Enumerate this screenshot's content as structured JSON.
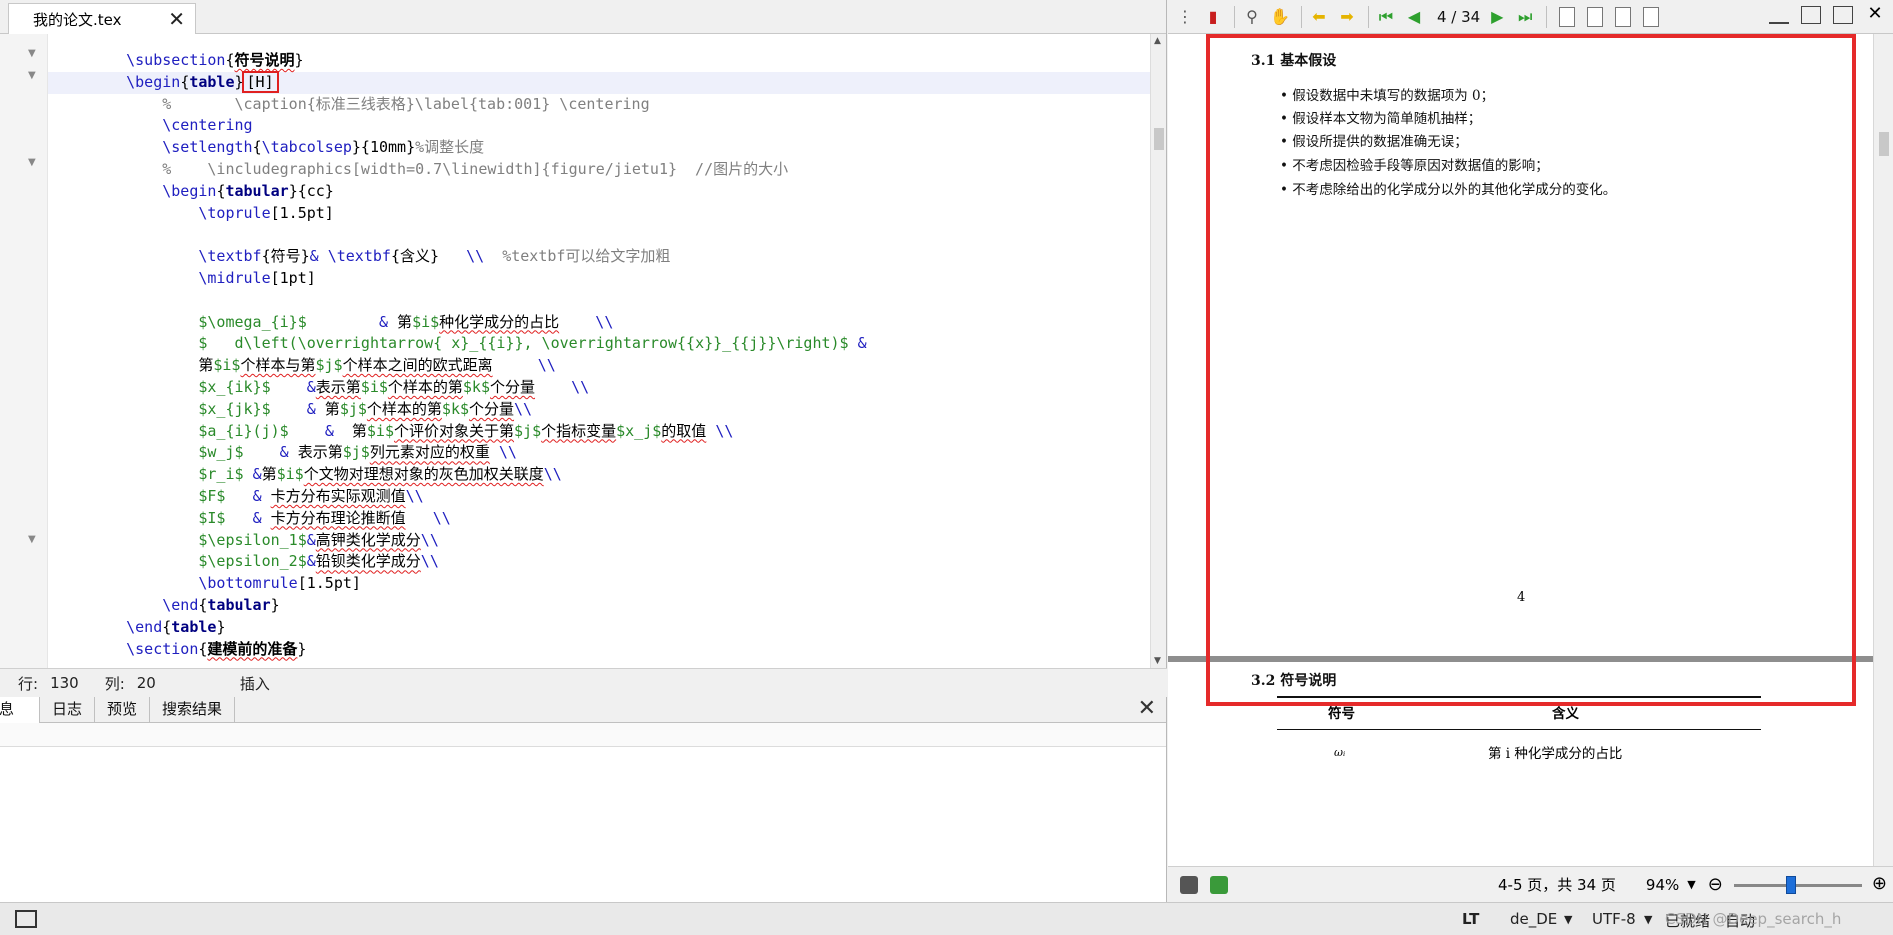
{
  "editor": {
    "tab_title": "我的论文.tex",
    "lines": [
      {
        "parts": [
          {
            "t": "    ",
            "c": ""
          },
          {
            "t": "\\subsection",
            "c": "kw"
          },
          {
            "t": "{",
            "c": ""
          },
          {
            "t": "符号说明",
            "c": "b"
          },
          {
            "t": "}",
            "c": ""
          }
        ]
      },
      {
        "parts": [
          {
            "t": "    ",
            "c": ""
          },
          {
            "t": "\\begin",
            "c": "kw"
          },
          {
            "t": "{",
            "c": ""
          },
          {
            "t": "table",
            "c": "kwb"
          },
          {
            "t": "}",
            "c": ""
          },
          {
            "t": "[H]",
            "c": "box"
          }
        ],
        "current": true
      },
      {
        "parts": [
          {
            "t": "        %       \\caption{标准三线表格}\\label{tab:001} \\centering",
            "c": "cm"
          }
        ]
      },
      {
        "parts": [
          {
            "t": "        ",
            "c": ""
          },
          {
            "t": "\\centering",
            "c": "kw"
          }
        ]
      },
      {
        "parts": [
          {
            "t": "        ",
            "c": ""
          },
          {
            "t": "\\setlength",
            "c": "kw"
          },
          {
            "t": "{",
            "c": ""
          },
          {
            "t": "\\tabcolsep",
            "c": "kw"
          },
          {
            "t": "}{10mm}",
            "c": ""
          },
          {
            "t": "%调整长度",
            "c": "cm"
          }
        ]
      },
      {
        "parts": [
          {
            "t": "        %    \\includegraphics[width=0.7\\linewidth]{figure/jietu1}  //图片的大小",
            "c": "cm"
          }
        ]
      },
      {
        "parts": [
          {
            "t": "        ",
            "c": ""
          },
          {
            "t": "\\begin",
            "c": "kw"
          },
          {
            "t": "{",
            "c": ""
          },
          {
            "t": "tabular",
            "c": "kwb"
          },
          {
            "t": "}{cc}",
            "c": ""
          }
        ]
      },
      {
        "parts": [
          {
            "t": "            ",
            "c": ""
          },
          {
            "t": "\\toprule",
            "c": "kw"
          },
          {
            "t": "[1.5pt]",
            "c": ""
          }
        ]
      },
      {
        "parts": [
          {
            "t": "",
            "c": ""
          }
        ]
      },
      {
        "parts": [
          {
            "t": "            ",
            "c": ""
          },
          {
            "t": "\\textbf",
            "c": "kw"
          },
          {
            "t": "{符号}",
            "c": ""
          },
          {
            "t": "&",
            "c": "kw"
          },
          {
            "t": " ",
            "c": ""
          },
          {
            "t": "\\textbf",
            "c": "kw"
          },
          {
            "t": "{含义}   ",
            "c": ""
          },
          {
            "t": "\\\\",
            "c": "kw"
          },
          {
            "t": "  %textbf可以给文字加粗",
            "c": "cm"
          }
        ]
      },
      {
        "parts": [
          {
            "t": "            ",
            "c": ""
          },
          {
            "t": "\\midrule",
            "c": "kw"
          },
          {
            "t": "[1pt]",
            "c": ""
          }
        ]
      },
      {
        "parts": [
          {
            "t": "",
            "c": ""
          }
        ]
      },
      {
        "parts": [
          {
            "t": "            ",
            "c": ""
          },
          {
            "t": "$\\omega_{i}$",
            "c": "ma"
          },
          {
            "t": "        ",
            "c": ""
          },
          {
            "t": "&",
            "c": "kw"
          },
          {
            "t": " 第",
            "c": ""
          },
          {
            "t": "$i$",
            "c": "ma"
          },
          {
            "t": "种化学成分的占比",
            "c": "sq"
          },
          {
            "t": "    ",
            "c": ""
          },
          {
            "t": "\\\\",
            "c": "kw"
          }
        ]
      },
      {
        "parts": [
          {
            "t": "            ",
            "c": ""
          },
          {
            "t": "$   d\\left(\\overrightarrow{ x}_{{i}}, \\overrightarrow{{x}}_{{j}}\\right)$",
            "c": "ma"
          },
          {
            "t": " ",
            "c": ""
          },
          {
            "t": "&",
            "c": "kw"
          }
        ]
      },
      {
        "parts": [
          {
            "t": "            第",
            "c": ""
          },
          {
            "t": "$i$",
            "c": "ma"
          },
          {
            "t": "个样本与第",
            "c": "sq"
          },
          {
            "t": "$j$",
            "c": "ma"
          },
          {
            "t": "个样本之间的欧式距离",
            "c": "sq"
          },
          {
            "t": "     ",
            "c": ""
          },
          {
            "t": "\\\\",
            "c": "kw"
          }
        ]
      },
      {
        "parts": [
          {
            "t": "            ",
            "c": ""
          },
          {
            "t": "$x_{ik}$",
            "c": "ma"
          },
          {
            "t": "    ",
            "c": ""
          },
          {
            "t": "&",
            "c": "kw"
          },
          {
            "t": "表示第",
            "c": "sq"
          },
          {
            "t": "$i$",
            "c": "ma"
          },
          {
            "t": "个样本的第",
            "c": "sq"
          },
          {
            "t": "$k$",
            "c": "ma"
          },
          {
            "t": "个分量",
            "c": "sq"
          },
          {
            "t": "    ",
            "c": ""
          },
          {
            "t": "\\\\",
            "c": "kw"
          }
        ]
      },
      {
        "parts": [
          {
            "t": "            ",
            "c": ""
          },
          {
            "t": "$x_{jk}$",
            "c": "ma"
          },
          {
            "t": "    ",
            "c": ""
          },
          {
            "t": "&",
            "c": "kw"
          },
          {
            "t": " 第",
            "c": ""
          },
          {
            "t": "$j$",
            "c": "ma"
          },
          {
            "t": "个样本的第",
            "c": "sq"
          },
          {
            "t": "$k$",
            "c": "ma"
          },
          {
            "t": "个分量",
            "c": "sq"
          },
          {
            "t": "\\\\",
            "c": "kw"
          }
        ]
      },
      {
        "parts": [
          {
            "t": "            ",
            "c": ""
          },
          {
            "t": "$a_{i}(j)$",
            "c": "ma"
          },
          {
            "t": "    ",
            "c": ""
          },
          {
            "t": "&",
            "c": "kw"
          },
          {
            "t": "  第",
            "c": ""
          },
          {
            "t": "$i$",
            "c": "ma"
          },
          {
            "t": "个评价对象关于第",
            "c": "sq"
          },
          {
            "t": "$j$",
            "c": "ma"
          },
          {
            "t": "个指标变量",
            "c": "sq"
          },
          {
            "t": "$x_j$",
            "c": "ma"
          },
          {
            "t": "的取值",
            "c": "sq"
          },
          {
            "t": " ",
            "c": ""
          },
          {
            "t": "\\\\",
            "c": "kw"
          }
        ]
      },
      {
        "parts": [
          {
            "t": "            ",
            "c": ""
          },
          {
            "t": "$w_j$",
            "c": "ma"
          },
          {
            "t": "    ",
            "c": ""
          },
          {
            "t": "&",
            "c": "kw"
          },
          {
            "t": " 表示第",
            "c": ""
          },
          {
            "t": "$j$",
            "c": "ma"
          },
          {
            "t": "列元素对应的权重",
            "c": "sq"
          },
          {
            "t": " ",
            "c": ""
          },
          {
            "t": "\\\\",
            "c": "kw"
          }
        ]
      },
      {
        "parts": [
          {
            "t": "            ",
            "c": ""
          },
          {
            "t": "$r_i$",
            "c": "ma"
          },
          {
            "t": " ",
            "c": ""
          },
          {
            "t": "&",
            "c": "kw"
          },
          {
            "t": "第",
            "c": ""
          },
          {
            "t": "$i$",
            "c": "ma"
          },
          {
            "t": "个文物对理想对象的灰色加权关联度",
            "c": "sq"
          },
          {
            "t": "\\\\",
            "c": "kw"
          }
        ]
      },
      {
        "parts": [
          {
            "t": "            ",
            "c": ""
          },
          {
            "t": "$F$",
            "c": "ma"
          },
          {
            "t": "   ",
            "c": ""
          },
          {
            "t": "&",
            "c": "kw"
          },
          {
            "t": " ",
            "c": ""
          },
          {
            "t": "卡方分布实际观测值",
            "c": "sq"
          },
          {
            "t": "\\\\",
            "c": "kw"
          }
        ]
      },
      {
        "parts": [
          {
            "t": "            ",
            "c": ""
          },
          {
            "t": "$I$",
            "c": "ma"
          },
          {
            "t": "   ",
            "c": ""
          },
          {
            "t": "&",
            "c": "kw"
          },
          {
            "t": " ",
            "c": ""
          },
          {
            "t": "卡方分布理论推断值",
            "c": "sq"
          },
          {
            "t": "   ",
            "c": ""
          },
          {
            "t": "\\\\",
            "c": "kw"
          }
        ]
      },
      {
        "parts": [
          {
            "t": "            ",
            "c": ""
          },
          {
            "t": "$\\epsilon_1$",
            "c": "ma"
          },
          {
            "t": "&",
            "c": "kw"
          },
          {
            "t": "高钾类化学成分",
            "c": "sq"
          },
          {
            "t": "\\\\",
            "c": "kw"
          }
        ]
      },
      {
        "parts": [
          {
            "t": "            ",
            "c": ""
          },
          {
            "t": "$\\epsilon_2$",
            "c": "ma"
          },
          {
            "t": "&",
            "c": "kw"
          },
          {
            "t": "铅钡类化学成分",
            "c": "sq"
          },
          {
            "t": "\\\\",
            "c": "kw"
          }
        ]
      },
      {
        "parts": [
          {
            "t": "            ",
            "c": ""
          },
          {
            "t": "\\bottomrule",
            "c": "kw"
          },
          {
            "t": "[1.5pt]",
            "c": ""
          }
        ]
      },
      {
        "parts": [
          {
            "t": "        ",
            "c": ""
          },
          {
            "t": "\\end",
            "c": "kw"
          },
          {
            "t": "{",
            "c": ""
          },
          {
            "t": "tabular",
            "c": "kwb"
          },
          {
            "t": "}",
            "c": ""
          }
        ]
      },
      {
        "parts": [
          {
            "t": "    ",
            "c": ""
          },
          {
            "t": "\\end",
            "c": "kw"
          },
          {
            "t": "{",
            "c": ""
          },
          {
            "t": "table",
            "c": "kwb"
          },
          {
            "t": "}",
            "c": ""
          }
        ]
      },
      {
        "parts": [
          {
            "t": "    ",
            "c": ""
          },
          {
            "t": "\\section",
            "c": "kw"
          },
          {
            "t": "{",
            "c": ""
          },
          {
            "t": "建模前的准备",
            "c": "b"
          },
          {
            "t": "}",
            "c": ""
          }
        ]
      }
    ],
    "status": {
      "row_label": "行:",
      "row": "130",
      "col_label": "列:",
      "col": "20",
      "mode": "插入"
    }
  },
  "bottom_panel": {
    "tabs": [
      "信息",
      "日志",
      "预览",
      "搜索结果"
    ]
  },
  "viewer": {
    "page_indicator": "4 / 34",
    "page1": {
      "section_title": "3.1  基本假设",
      "bullets": [
        "• 假设数据中未填写的数据项为 0；",
        "• 假设样本文物为简单随机抽样；",
        "• 假设所提供的数据准确无误；",
        "• 不考虑因检验手段等原因对数据值的影响；",
        "• 不考虑除给出的化学成分以外的其他化学成分的变化。"
      ],
      "page_number": "4"
    },
    "page2": {
      "section_title": "3.2  符号说明",
      "table_headers": [
        "符号",
        "含义"
      ],
      "first_row": [
        "ωᵢ",
        "第 i 种化学成分的占比"
      ]
    },
    "status": {
      "pages": "4-5 页，共 34 页",
      "zoom": "94%"
    }
  },
  "app_status": {
    "lang": "de_DE",
    "encoding": "UTF-8",
    "ready": "已就绪",
    "auto": "自动",
    "watermark": "CSDN @Deep_search_h"
  },
  "accent_colors": {
    "annotation_red": "#e52a2a",
    "latex_keyword": "#2020c0",
    "latex_math": "#2a8a2a",
    "latex_comment": "#808080"
  }
}
